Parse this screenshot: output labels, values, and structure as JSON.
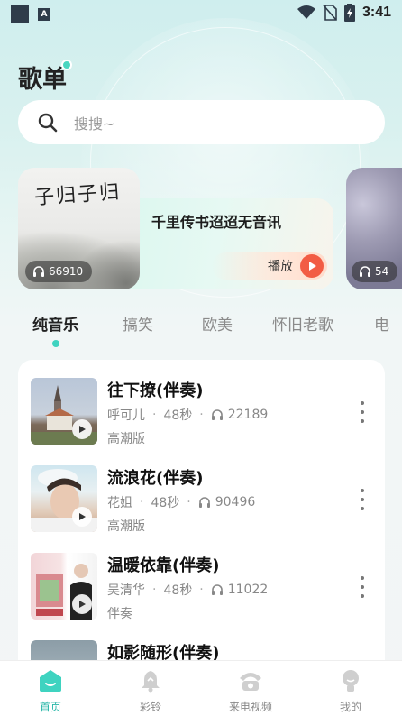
{
  "status_bar": {
    "time": "3:41"
  },
  "page": {
    "title": "歌单"
  },
  "search": {
    "placeholder": "搜搜~"
  },
  "banner": {
    "cover_text": "子归子归",
    "play_count": "66910",
    "title": "千里传书迢迢无音讯",
    "play_label": "播放",
    "next_play_count": "54"
  },
  "tabs": [
    {
      "label": "纯音乐",
      "active": true
    },
    {
      "label": "搞笑",
      "active": false
    },
    {
      "label": "欧美",
      "active": false
    },
    {
      "label": "怀旧老歌",
      "active": false
    },
    {
      "label": "电",
      "active": false
    }
  ],
  "songs": [
    {
      "title": "往下撩(伴奏)",
      "artist": "呼可儿",
      "duration": "48秒",
      "plays": "22189",
      "tag": "高潮版"
    },
    {
      "title": "流浪花(伴奏)",
      "artist": "花姐",
      "duration": "48秒",
      "plays": "90496",
      "tag": "高潮版"
    },
    {
      "title": "温暖依靠(伴奏)",
      "artist": "吴清华",
      "duration": "48秒",
      "plays": "11022",
      "tag": "伴奏"
    },
    {
      "title": "如影随形(伴奏)",
      "artist": "",
      "duration": "",
      "plays": "",
      "tag": ""
    }
  ],
  "bottom_nav": [
    {
      "label": "首页",
      "icon": "home-icon",
      "active": true
    },
    {
      "label": "彩铃",
      "icon": "bell-icon",
      "active": false
    },
    {
      "label": "来电视频",
      "icon": "phone-icon",
      "active": false
    },
    {
      "label": "我的",
      "icon": "profile-icon",
      "active": false
    }
  ],
  "colors": {
    "accent": "#3fd3c0",
    "play_button": "#f25c44",
    "active_nav": "#28b7a8"
  }
}
